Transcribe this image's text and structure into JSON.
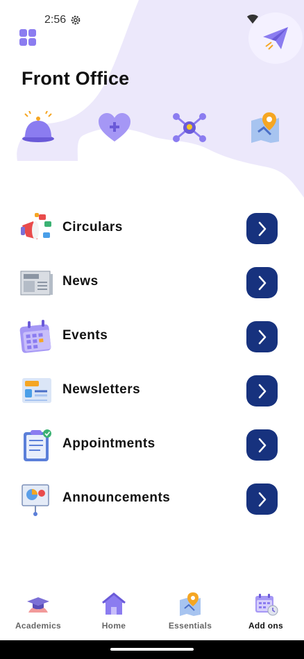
{
  "status": {
    "time": "2:56"
  },
  "header": {
    "title": "Front Office"
  },
  "quick_icons": [
    "bell-icon",
    "heart-icon",
    "network-icon",
    "map-icon"
  ],
  "menu": [
    {
      "label": "Circulars",
      "icon": "megaphone-icon"
    },
    {
      "label": "News",
      "icon": "newspaper-icon"
    },
    {
      "label": "Events",
      "icon": "calendar-icon"
    },
    {
      "label": "Newsletters",
      "icon": "newsletter-icon"
    },
    {
      "label": "Appointments",
      "icon": "clipboard-icon"
    },
    {
      "label": "Announcements",
      "icon": "presentation-icon"
    }
  ],
  "bottom_nav": [
    {
      "label": "Academics",
      "icon": "graduation-cap-icon"
    },
    {
      "label": "Home",
      "icon": "home-icon"
    },
    {
      "label": "Essentials",
      "icon": "map-pin-icon"
    },
    {
      "label": "Add ons",
      "icon": "calendar-clock-icon",
      "active": true
    }
  ],
  "colors": {
    "accent": "#17327e",
    "purple": "#8b7cf0",
    "blob": "#ebe7fb"
  }
}
